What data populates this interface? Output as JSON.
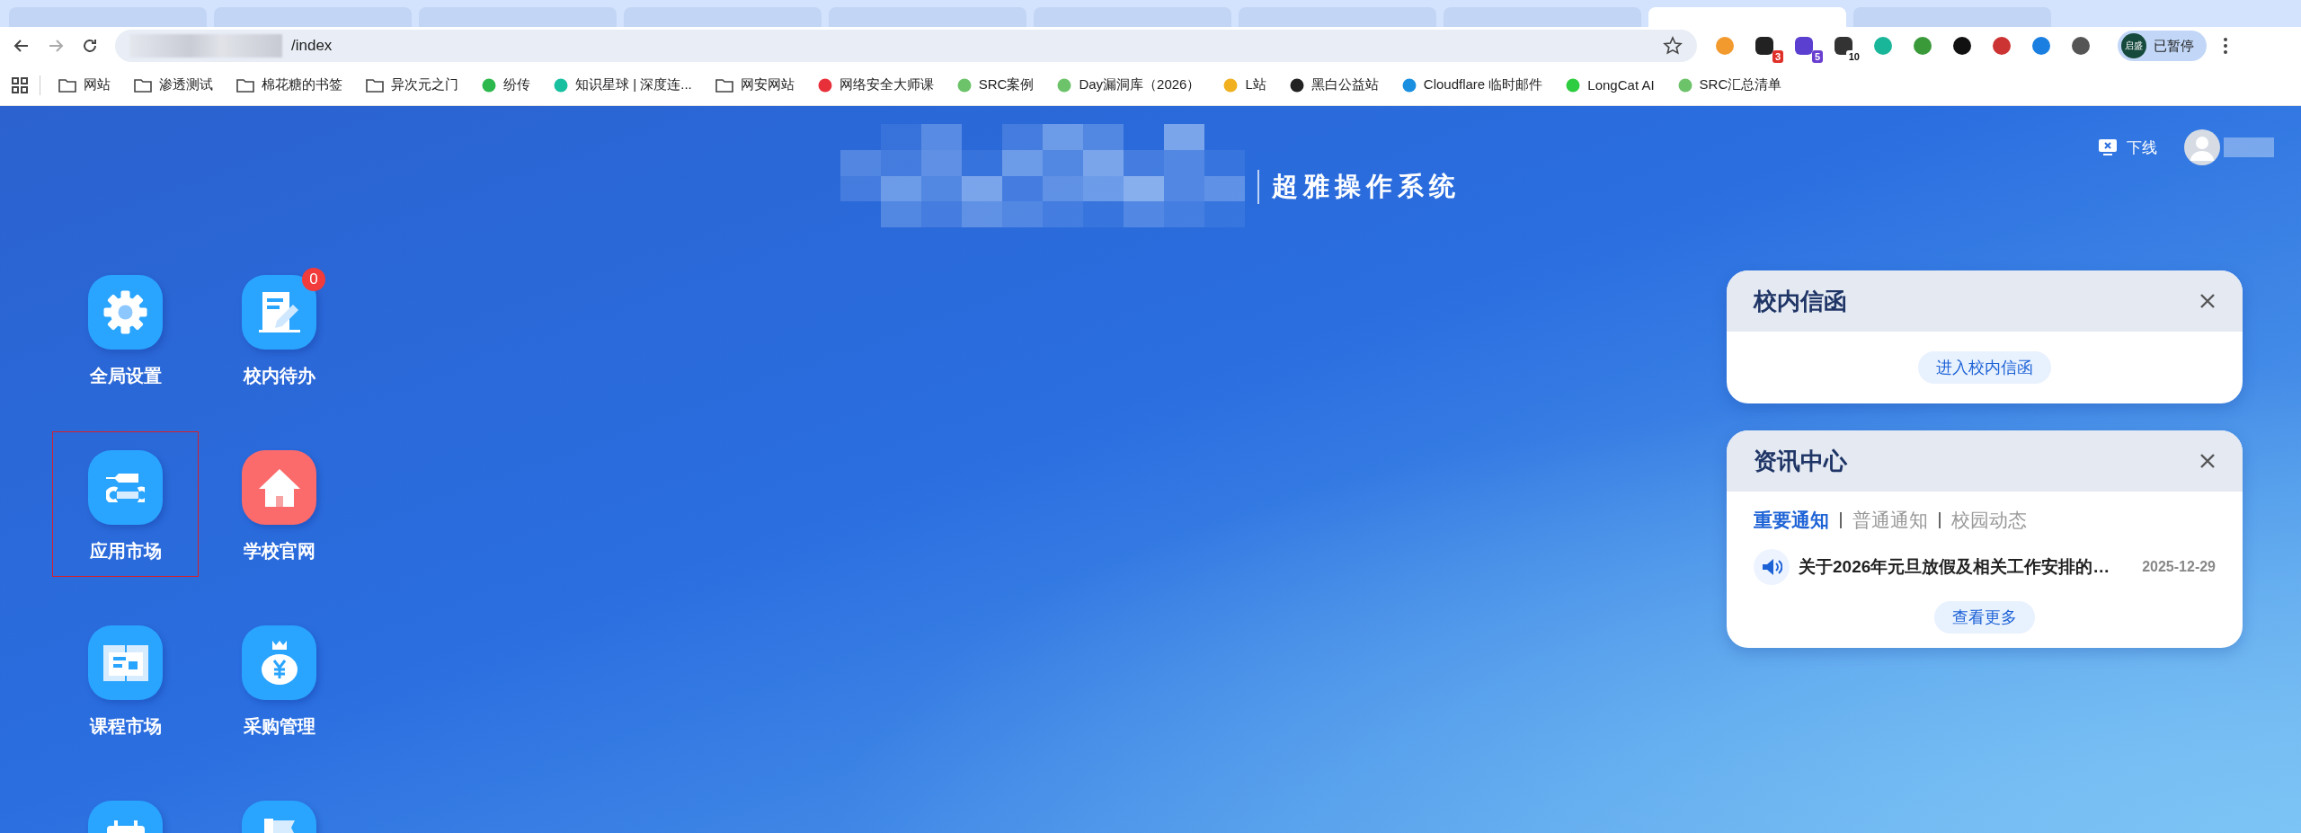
{
  "browser": {
    "address": "/index",
    "extensions": [
      {
        "kind": "plain"
      },
      {
        "kind": "badged",
        "badge": "3",
        "color": "#e0302a"
      },
      {
        "kind": "badged",
        "badge": "5",
        "color": "#6a3fd0"
      },
      {
        "kind": "badged",
        "badge": "10",
        "color": "#ffffff"
      },
      {
        "kind": "plain"
      },
      {
        "kind": "plain"
      },
      {
        "kind": "plain"
      },
      {
        "kind": "plain"
      },
      {
        "kind": "plain"
      },
      {
        "kind": "plain"
      }
    ],
    "profile": {
      "initials": "启盛",
      "status": "已暂停"
    },
    "bookmarks": [
      {
        "label": "网站",
        "kind": "folder"
      },
      {
        "label": "渗透测试",
        "kind": "folder"
      },
      {
        "label": "棉花糖的书签",
        "kind": "folder"
      },
      {
        "label": "异次元之门",
        "kind": "folder"
      },
      {
        "label": "纷传",
        "kind": "site",
        "color": "#2db84d"
      },
      {
        "label": "知识星球 | 深度连...",
        "kind": "site",
        "color": "#19c0a0"
      },
      {
        "label": "网安网站",
        "kind": "folder"
      },
      {
        "label": "网络安全大师课",
        "kind": "site",
        "color": "#e8303a"
      },
      {
        "label": "SRC案例",
        "kind": "site",
        "color": "#6cc36a"
      },
      {
        "label": "Day漏洞库（2026）",
        "kind": "site",
        "color": "#6cc36a"
      },
      {
        "label": "L站",
        "kind": "site",
        "color": "#f0b020"
      },
      {
        "label": "黑白公益站",
        "kind": "site",
        "color": "#222222"
      },
      {
        "label": "Cloudflare 临时邮件",
        "kind": "site",
        "color": "#1a8fe0"
      },
      {
        "label": "LongCat AI",
        "kind": "site",
        "color": "#2ecc40"
      },
      {
        "label": "SRC汇总清单",
        "kind": "site",
        "color": "#6cc36a"
      }
    ]
  },
  "header": {
    "title": "超雅操作系统",
    "logout": "下线"
  },
  "app_rows": [
    {
      "apps": [
        {
          "label": "全局设置",
          "kind": "gear",
          "selected": false
        },
        {
          "label": "校内待办",
          "kind": "todo",
          "badge": "0",
          "selected": false
        }
      ]
    },
    {
      "apps": [
        {
          "label": "应用市场",
          "kind": "tools",
          "selected": true
        },
        {
          "label": "学校官网",
          "kind": "home",
          "selected": false
        }
      ]
    },
    {
      "apps": [
        {
          "label": "课程市场",
          "kind": "book",
          "selected": false
        },
        {
          "label": "采购管理",
          "kind": "moneybag",
          "selected": false
        }
      ]
    },
    {
      "apps": [
        {
          "kind": "calendar",
          "selected": false
        },
        {
          "kind": "flag",
          "selected": false
        }
      ]
    }
  ],
  "panels": [
    {
      "title": "校内信函",
      "kind": "mail",
      "button": "进入校内信函"
    },
    {
      "title": "资讯中心",
      "kind": "news",
      "tabs": [
        {
          "label": "重要通知",
          "selected": true
        },
        {
          "label": "普通通知",
          "selected": false
        },
        {
          "label": "校园动态",
          "selected": false
        }
      ],
      "items": [
        {
          "title": "关于2026年元旦放假及相关工作安排的…",
          "date": "2025-12-29"
        }
      ],
      "button": "查看更多"
    }
  ]
}
